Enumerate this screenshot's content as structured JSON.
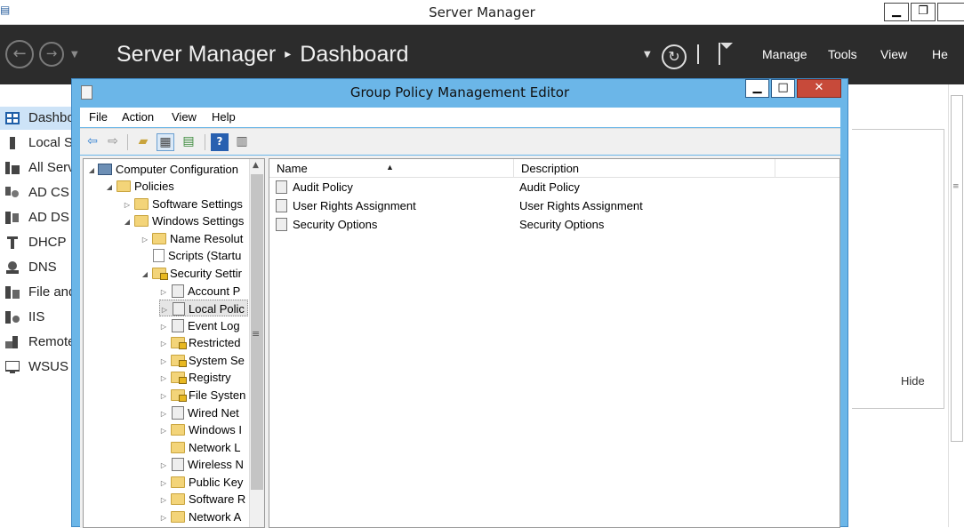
{
  "server_manager": {
    "title": "Server Manager",
    "breadcrumb_root": "Server Manager",
    "breadcrumb_sep": "▸",
    "breadcrumb_page": "Dashboard",
    "header_menu": [
      "Manage",
      "Tools",
      "View",
      "He"
    ],
    "sidebar": [
      {
        "label": "Dashbo",
        "icon": "dashboard-icon",
        "active": true
      },
      {
        "label": "Local S",
        "icon": "server-icon"
      },
      {
        "label": "All Serv",
        "icon": "servers-icon"
      },
      {
        "label": "AD CS",
        "icon": "certificate-icon"
      },
      {
        "label": "AD DS",
        "icon": "directory-icon"
      },
      {
        "label": "DHCP",
        "icon": "dhcp-icon"
      },
      {
        "label": "DNS",
        "icon": "dns-icon"
      },
      {
        "label": "File and",
        "icon": "file-services-icon"
      },
      {
        "label": "IIS",
        "icon": "iis-icon"
      },
      {
        "label": "Remote",
        "icon": "remote-icon"
      },
      {
        "label": "WSUS",
        "icon": "wsus-icon"
      }
    ],
    "hide_label": "Hide"
  },
  "gpme": {
    "title": "Group Policy Management Editor",
    "menu": [
      "File",
      "Action",
      "View",
      "Help"
    ],
    "tree": [
      {
        "label": "Computer Configuration",
        "toggle": "◢",
        "icon": "computer"
      },
      {
        "label": "Policies",
        "toggle": "◢",
        "icon": "folder"
      },
      {
        "label": "Software Settings",
        "toggle": "▷",
        "icon": "folder"
      },
      {
        "label": "Windows Settings",
        "toggle": "◢",
        "icon": "folder"
      },
      {
        "label": "Name Resolut",
        "toggle": "▷",
        "icon": "folder"
      },
      {
        "label": "Scripts (Startu",
        "toggle": "",
        "icon": "script"
      },
      {
        "label": "Security Settir",
        "toggle": "◢",
        "icon": "folder-lock"
      },
      {
        "label": "Account P",
        "toggle": "▷",
        "icon": "policy"
      },
      {
        "label": "Local Polic",
        "toggle": "▷",
        "icon": "policy",
        "selected": true
      },
      {
        "label": "Event Log",
        "toggle": "▷",
        "icon": "policy"
      },
      {
        "label": "Restricted",
        "toggle": "▷",
        "icon": "folder-lock"
      },
      {
        "label": "System Se",
        "toggle": "▷",
        "icon": "folder-lock"
      },
      {
        "label": "Registry",
        "toggle": "▷",
        "icon": "folder-lock"
      },
      {
        "label": "File Systen",
        "toggle": "▷",
        "icon": "folder-lock"
      },
      {
        "label": "Wired Net",
        "toggle": "▷",
        "icon": "policy"
      },
      {
        "label": "Windows I",
        "toggle": "▷",
        "icon": "folder"
      },
      {
        "label": "Network L",
        "toggle": "",
        "icon": "folder"
      },
      {
        "label": "Wireless N",
        "toggle": "▷",
        "icon": "policy"
      },
      {
        "label": "Public Key",
        "toggle": "▷",
        "icon": "folder"
      },
      {
        "label": "Software R",
        "toggle": "▷",
        "icon": "folder"
      },
      {
        "label": "Network A",
        "toggle": "▷",
        "icon": "folder"
      }
    ],
    "list": {
      "col_name": "Name",
      "col_desc": "Description",
      "rows": [
        {
          "name": "Audit Policy",
          "desc": "Audit Policy"
        },
        {
          "name": "User Rights Assignment",
          "desc": "User Rights Assignment"
        },
        {
          "name": "Security Options",
          "desc": "Security Options"
        }
      ]
    }
  }
}
